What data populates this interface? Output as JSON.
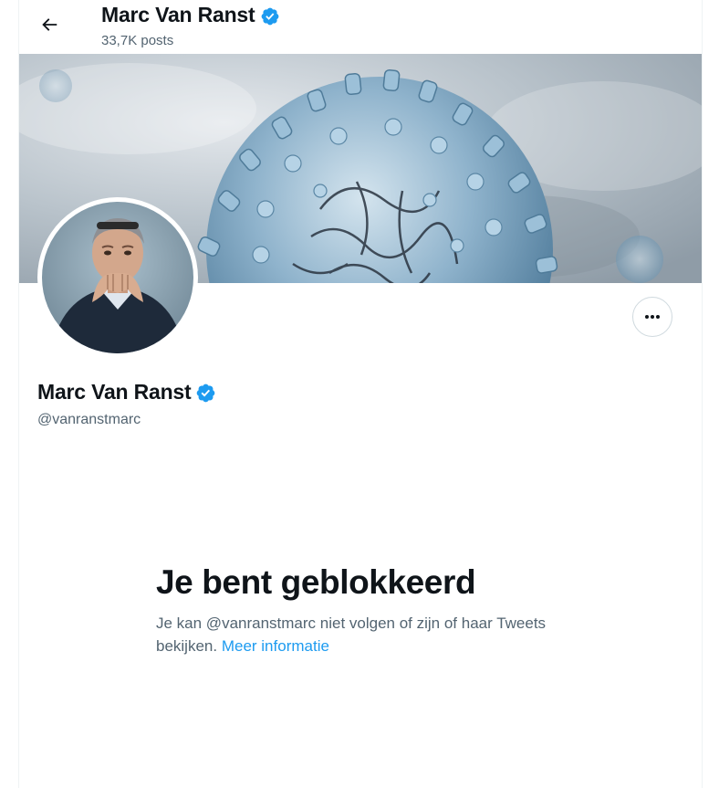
{
  "header": {
    "back_icon": "arrow-left-icon",
    "name": "Marc Van Ranst",
    "verified_icon": "verified-badge-icon",
    "posts_count": "33,7K posts"
  },
  "banner": {
    "description_icon": "virus-banner-image"
  },
  "profile": {
    "avatar_icon": "profile-photo",
    "more_icon": "more-dots-icon",
    "name": "Marc Van Ranst",
    "handle": "@vanranstmarc"
  },
  "blocked": {
    "title": "Je bent geblokkeerd",
    "text": "Je kan @vanranstmarc niet volgen of zijn of haar Tweets bekijken. ",
    "link": "Meer informatie"
  },
  "colors": {
    "accent": "#1d9bf0",
    "text": "#0f1419",
    "secondary": "#536471",
    "border": "#cfd9de"
  }
}
